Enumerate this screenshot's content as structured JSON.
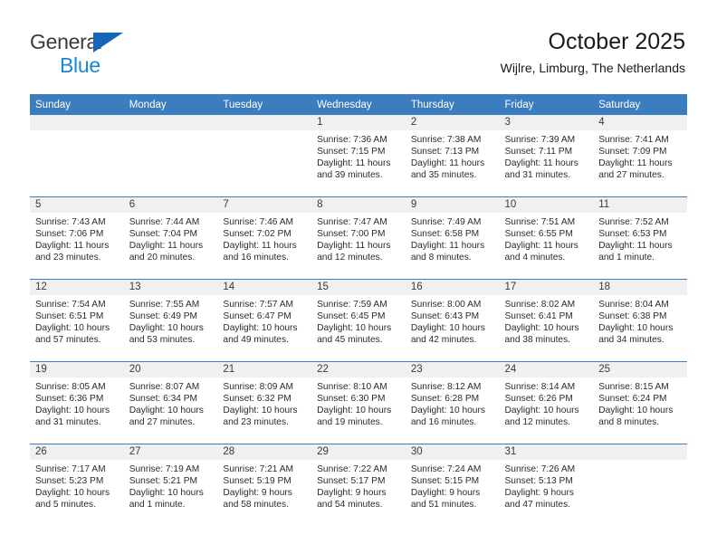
{
  "logo": {
    "word1": "General",
    "word2": "Blue",
    "triangle_color": "#1565b8",
    "word2_color": "#1b86d6"
  },
  "header": {
    "title": "October 2025",
    "subtitle": "Wijlre, Limburg, The Netherlands"
  },
  "theme": {
    "header_blue": "#3c7dbf",
    "daynum_bg": "#f0f0f0"
  },
  "weekdays": [
    "Sunday",
    "Monday",
    "Tuesday",
    "Wednesday",
    "Thursday",
    "Friday",
    "Saturday"
  ],
  "weeks": [
    [
      {
        "day": "",
        "empty": true
      },
      {
        "day": "",
        "empty": true
      },
      {
        "day": "",
        "empty": true
      },
      {
        "day": "1",
        "sunrise": "Sunrise: 7:36 AM",
        "sunset": "Sunset: 7:15 PM",
        "daylight": "Daylight: 11 hours and 39 minutes."
      },
      {
        "day": "2",
        "sunrise": "Sunrise: 7:38 AM",
        "sunset": "Sunset: 7:13 PM",
        "daylight": "Daylight: 11 hours and 35 minutes."
      },
      {
        "day": "3",
        "sunrise": "Sunrise: 7:39 AM",
        "sunset": "Sunset: 7:11 PM",
        "daylight": "Daylight: 11 hours and 31 minutes."
      },
      {
        "day": "4",
        "sunrise": "Sunrise: 7:41 AM",
        "sunset": "Sunset: 7:09 PM",
        "daylight": "Daylight: 11 hours and 27 minutes."
      }
    ],
    [
      {
        "day": "5",
        "sunrise": "Sunrise: 7:43 AM",
        "sunset": "Sunset: 7:06 PM",
        "daylight": "Daylight: 11 hours and 23 minutes."
      },
      {
        "day": "6",
        "sunrise": "Sunrise: 7:44 AM",
        "sunset": "Sunset: 7:04 PM",
        "daylight": "Daylight: 11 hours and 20 minutes."
      },
      {
        "day": "7",
        "sunrise": "Sunrise: 7:46 AM",
        "sunset": "Sunset: 7:02 PM",
        "daylight": "Daylight: 11 hours and 16 minutes."
      },
      {
        "day": "8",
        "sunrise": "Sunrise: 7:47 AM",
        "sunset": "Sunset: 7:00 PM",
        "daylight": "Daylight: 11 hours and 12 minutes."
      },
      {
        "day": "9",
        "sunrise": "Sunrise: 7:49 AM",
        "sunset": "Sunset: 6:58 PM",
        "daylight": "Daylight: 11 hours and 8 minutes."
      },
      {
        "day": "10",
        "sunrise": "Sunrise: 7:51 AM",
        "sunset": "Sunset: 6:55 PM",
        "daylight": "Daylight: 11 hours and 4 minutes."
      },
      {
        "day": "11",
        "sunrise": "Sunrise: 7:52 AM",
        "sunset": "Sunset: 6:53 PM",
        "daylight": "Daylight: 11 hours and 1 minute."
      }
    ],
    [
      {
        "day": "12",
        "sunrise": "Sunrise: 7:54 AM",
        "sunset": "Sunset: 6:51 PM",
        "daylight": "Daylight: 10 hours and 57 minutes."
      },
      {
        "day": "13",
        "sunrise": "Sunrise: 7:55 AM",
        "sunset": "Sunset: 6:49 PM",
        "daylight": "Daylight: 10 hours and 53 minutes."
      },
      {
        "day": "14",
        "sunrise": "Sunrise: 7:57 AM",
        "sunset": "Sunset: 6:47 PM",
        "daylight": "Daylight: 10 hours and 49 minutes."
      },
      {
        "day": "15",
        "sunrise": "Sunrise: 7:59 AM",
        "sunset": "Sunset: 6:45 PM",
        "daylight": "Daylight: 10 hours and 45 minutes."
      },
      {
        "day": "16",
        "sunrise": "Sunrise: 8:00 AM",
        "sunset": "Sunset: 6:43 PM",
        "daylight": "Daylight: 10 hours and 42 minutes."
      },
      {
        "day": "17",
        "sunrise": "Sunrise: 8:02 AM",
        "sunset": "Sunset: 6:41 PM",
        "daylight": "Daylight: 10 hours and 38 minutes."
      },
      {
        "day": "18",
        "sunrise": "Sunrise: 8:04 AM",
        "sunset": "Sunset: 6:38 PM",
        "daylight": "Daylight: 10 hours and 34 minutes."
      }
    ],
    [
      {
        "day": "19",
        "sunrise": "Sunrise: 8:05 AM",
        "sunset": "Sunset: 6:36 PM",
        "daylight": "Daylight: 10 hours and 31 minutes."
      },
      {
        "day": "20",
        "sunrise": "Sunrise: 8:07 AM",
        "sunset": "Sunset: 6:34 PM",
        "daylight": "Daylight: 10 hours and 27 minutes."
      },
      {
        "day": "21",
        "sunrise": "Sunrise: 8:09 AM",
        "sunset": "Sunset: 6:32 PM",
        "daylight": "Daylight: 10 hours and 23 minutes."
      },
      {
        "day": "22",
        "sunrise": "Sunrise: 8:10 AM",
        "sunset": "Sunset: 6:30 PM",
        "daylight": "Daylight: 10 hours and 19 minutes."
      },
      {
        "day": "23",
        "sunrise": "Sunrise: 8:12 AM",
        "sunset": "Sunset: 6:28 PM",
        "daylight": "Daylight: 10 hours and 16 minutes."
      },
      {
        "day": "24",
        "sunrise": "Sunrise: 8:14 AM",
        "sunset": "Sunset: 6:26 PM",
        "daylight": "Daylight: 10 hours and 12 minutes."
      },
      {
        "day": "25",
        "sunrise": "Sunrise: 8:15 AM",
        "sunset": "Sunset: 6:24 PM",
        "daylight": "Daylight: 10 hours and 8 minutes."
      }
    ],
    [
      {
        "day": "26",
        "sunrise": "Sunrise: 7:17 AM",
        "sunset": "Sunset: 5:23 PM",
        "daylight": "Daylight: 10 hours and 5 minutes."
      },
      {
        "day": "27",
        "sunrise": "Sunrise: 7:19 AM",
        "sunset": "Sunset: 5:21 PM",
        "daylight": "Daylight: 10 hours and 1 minute."
      },
      {
        "day": "28",
        "sunrise": "Sunrise: 7:21 AM",
        "sunset": "Sunset: 5:19 PM",
        "daylight": "Daylight: 9 hours and 58 minutes."
      },
      {
        "day": "29",
        "sunrise": "Sunrise: 7:22 AM",
        "sunset": "Sunset: 5:17 PM",
        "daylight": "Daylight: 9 hours and 54 minutes."
      },
      {
        "day": "30",
        "sunrise": "Sunrise: 7:24 AM",
        "sunset": "Sunset: 5:15 PM",
        "daylight": "Daylight: 9 hours and 51 minutes."
      },
      {
        "day": "31",
        "sunrise": "Sunrise: 7:26 AM",
        "sunset": "Sunset: 5:13 PM",
        "daylight": "Daylight: 9 hours and 47 minutes."
      },
      {
        "day": "",
        "empty": true
      }
    ]
  ]
}
